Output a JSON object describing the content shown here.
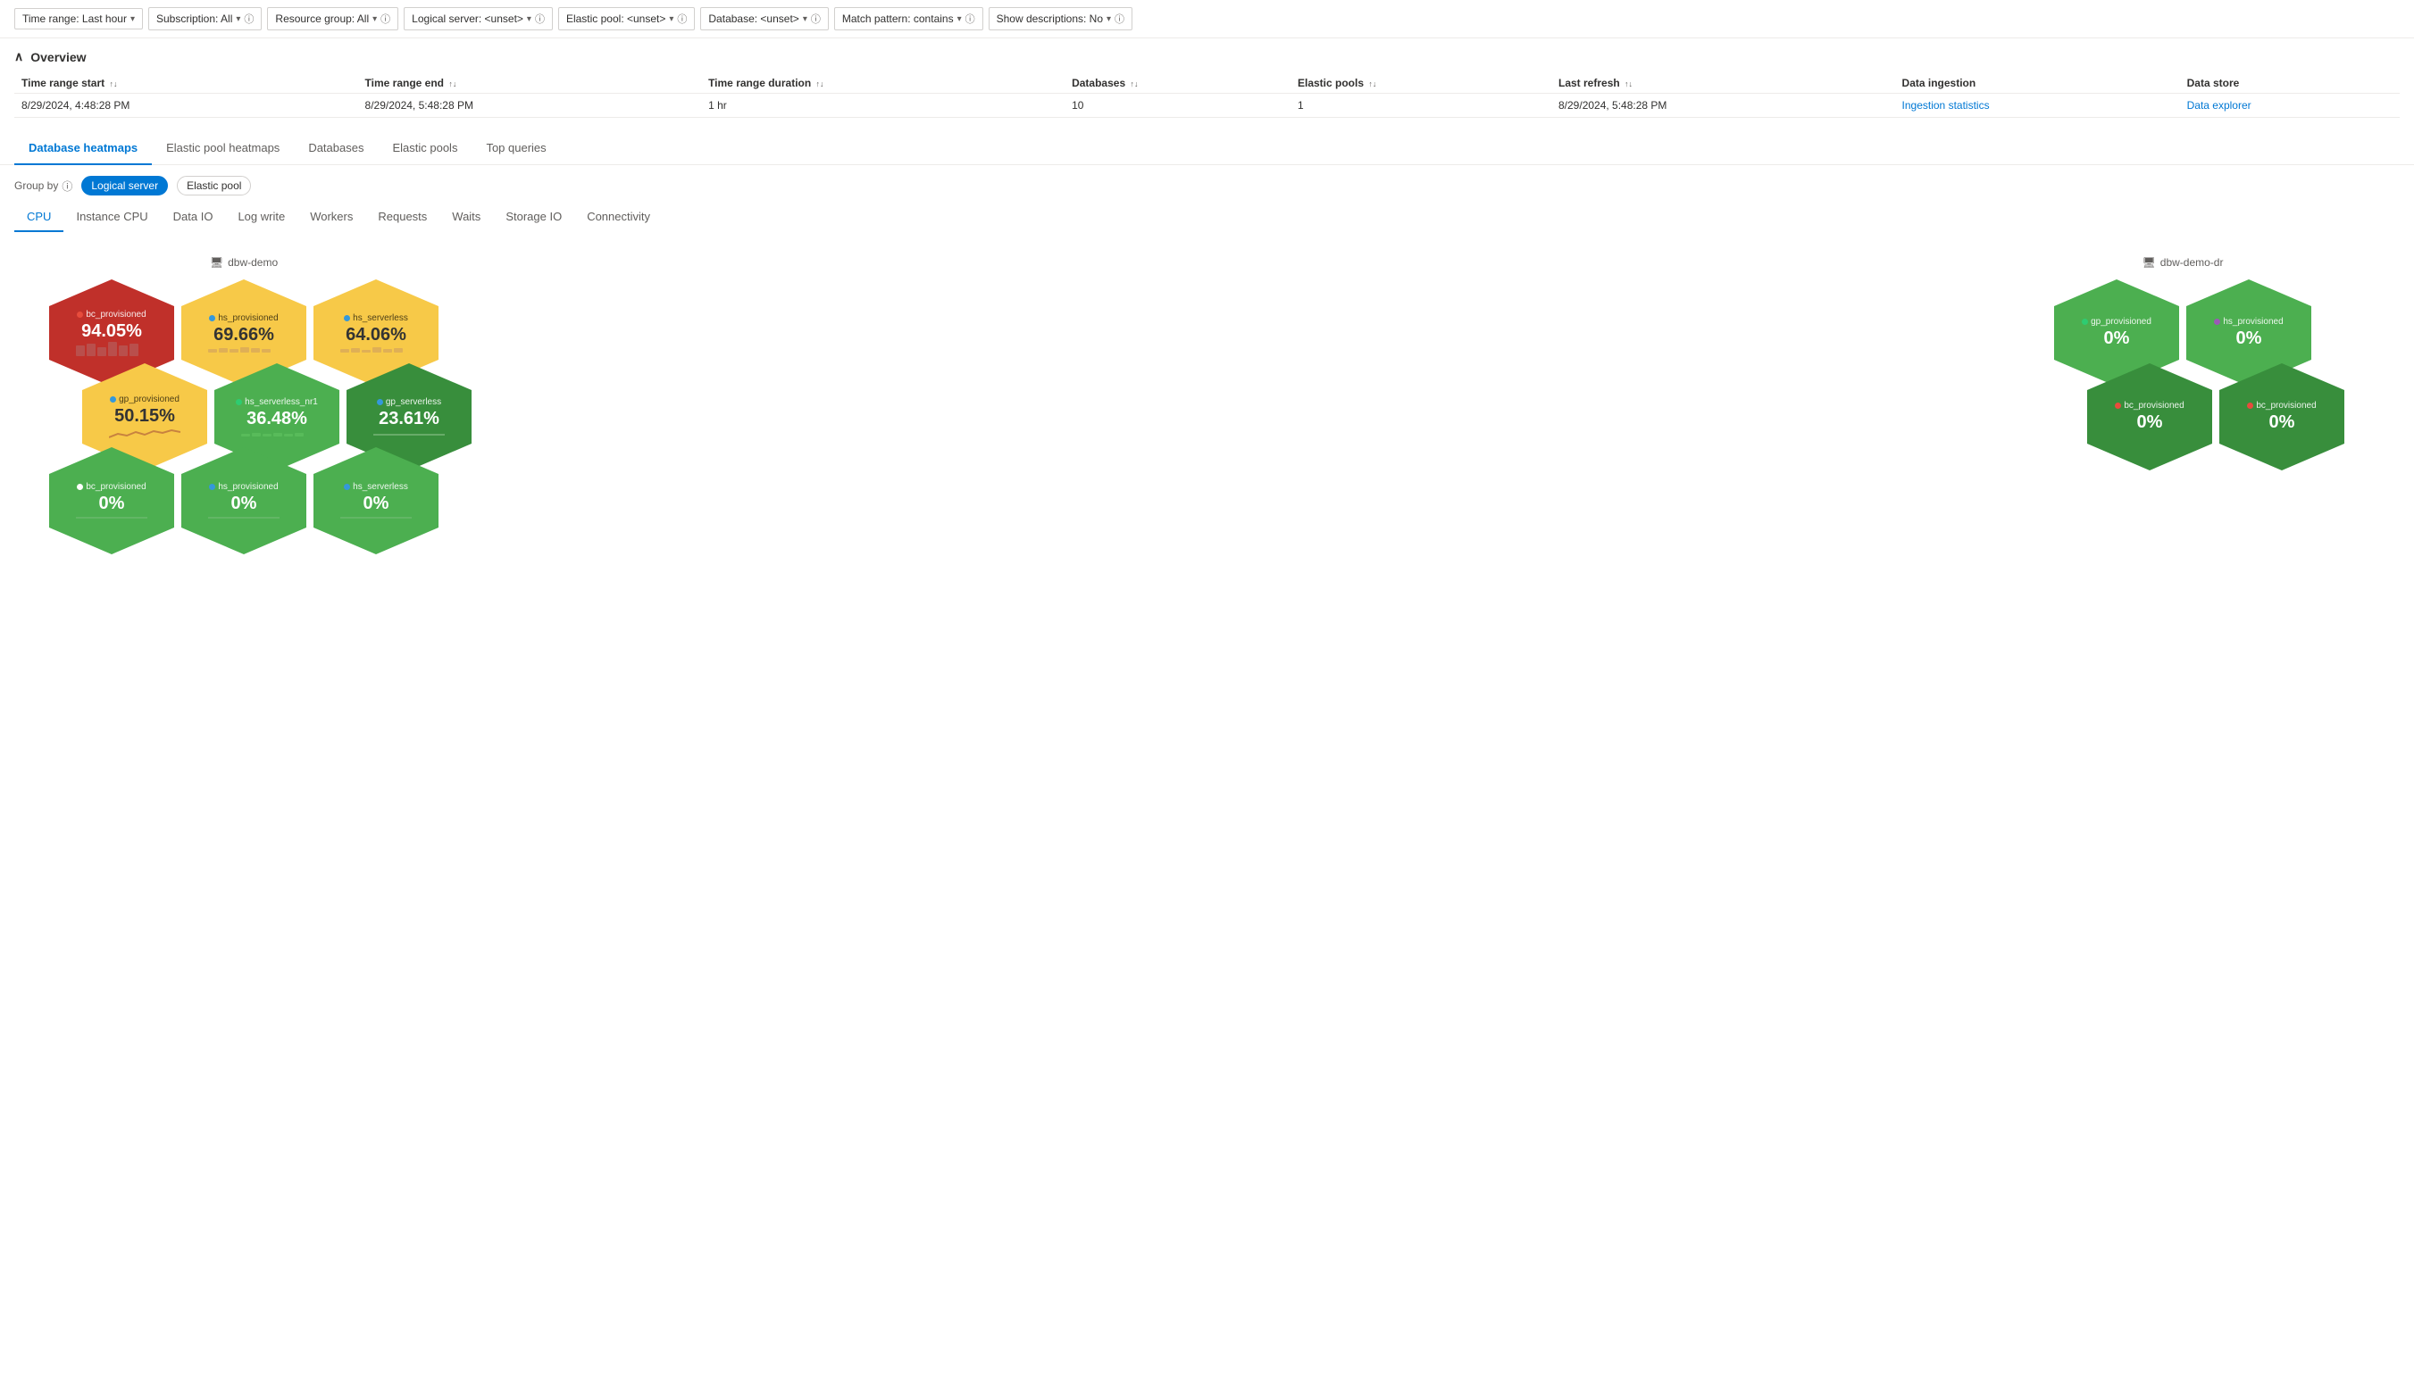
{
  "filters": [
    {
      "label": "Time range: Last hour",
      "has_chevron": true,
      "has_info": false
    },
    {
      "label": "Subscription: All",
      "has_chevron": true,
      "has_info": true
    },
    {
      "label": "Resource group: All",
      "has_chevron": true,
      "has_info": true
    },
    {
      "label": "Logical server: <unset>",
      "has_chevron": true,
      "has_info": true
    },
    {
      "label": "Elastic pool: <unset>",
      "has_chevron": true,
      "has_info": true
    },
    {
      "label": "Database: <unset>",
      "has_chevron": true,
      "has_info": true
    },
    {
      "label": "Match pattern: contains",
      "has_chevron": true,
      "has_info": true
    },
    {
      "label": "Show descriptions: No",
      "has_chevron": true,
      "has_info": true
    }
  ],
  "overview": {
    "title": "Overview",
    "columns": [
      "Time range start",
      "Time range end",
      "Time range duration",
      "Databases",
      "Elastic pools",
      "Last refresh",
      "Data ingestion",
      "Data store"
    ],
    "row": {
      "time_start": "8/29/2024, 4:48:28 PM",
      "time_end": "8/29/2024, 5:48:28 PM",
      "duration": "1 hr",
      "databases": "10",
      "elastic_pools": "1",
      "last_refresh": "8/29/2024, 5:48:28 PM",
      "ingestion_link": "Ingestion statistics",
      "data_store_link": "Data explorer"
    }
  },
  "main_tabs": [
    {
      "label": "Database heatmaps",
      "active": true
    },
    {
      "label": "Elastic pool heatmaps",
      "active": false
    },
    {
      "label": "Databases",
      "active": false
    },
    {
      "label": "Elastic pools",
      "active": false
    },
    {
      "label": "Top queries",
      "active": false
    }
  ],
  "group_by": {
    "label": "Group by",
    "options": [
      {
        "label": "Logical server",
        "active": true
      },
      {
        "label": "Elastic pool",
        "active": false
      }
    ]
  },
  "sub_tabs": [
    {
      "label": "CPU",
      "active": true
    },
    {
      "label": "Instance CPU",
      "active": false
    },
    {
      "label": "Data IO",
      "active": false
    },
    {
      "label": "Log write",
      "active": false
    },
    {
      "label": "Workers",
      "active": false
    },
    {
      "label": "Requests",
      "active": false
    },
    {
      "label": "Waits",
      "active": false
    },
    {
      "label": "Storage IO",
      "active": false
    },
    {
      "label": "Connectivity",
      "active": false
    }
  ],
  "heatmap_left": {
    "server_name": "dbw-demo",
    "hexagons": [
      {
        "row": 0,
        "cells": [
          {
            "name": "bc_provisioned",
            "value": "94.05%",
            "color": "red",
            "dot_color": "#e74c3c",
            "sparkline": "high"
          },
          {
            "name": "hs_provisioned",
            "value": "69.66%",
            "color": "yellow",
            "dot_color": "#3498db",
            "sparkline": "medium"
          },
          {
            "name": "hs_serverless",
            "value": "64.06%",
            "color": "yellow",
            "dot_color": "#3498db",
            "sparkline": "medium"
          }
        ]
      },
      {
        "row": 1,
        "cells": [
          {
            "name": "gp_provisioned",
            "value": "50.15%",
            "color": "yellow",
            "dot_color": "#3498db",
            "sparkline": "wave"
          },
          {
            "name": "hs_serverless_nr1",
            "value": "36.48%",
            "color": "green",
            "dot_color": "#2ecc71",
            "sparkline": "low"
          },
          {
            "name": "gp_serverless",
            "value": "23.61%",
            "color": "dark-green",
            "dot_color": "#3498db",
            "sparkline": "flat"
          }
        ]
      },
      {
        "row": 2,
        "cells": [
          {
            "name": "bc_provisioned",
            "value": "0%",
            "color": "green",
            "dot_color": "#fff",
            "sparkline": "flat"
          },
          {
            "name": "hs_provisioned",
            "value": "0%",
            "color": "green",
            "dot_color": "#3498db",
            "sparkline": "flat"
          },
          {
            "name": "hs_serverless",
            "value": "0%",
            "color": "green",
            "dot_color": "#3498db",
            "sparkline": "flat"
          }
        ]
      }
    ]
  },
  "heatmap_right": {
    "server_name": "dbw-demo-dr",
    "hexagons": [
      {
        "row": 0,
        "cells": [
          {
            "name": "gp_provisioned",
            "value": "0%",
            "color": "green",
            "dot_color": "#2ecc71"
          },
          {
            "name": "hs_provisioned",
            "value": "0%",
            "color": "green",
            "dot_color": "#9b59b6"
          }
        ]
      },
      {
        "row": 1,
        "cells": [
          {
            "name": "bc_provisioned",
            "value": "0%",
            "color": "dark-green",
            "dot_color": "#e74c3c"
          },
          {
            "name": "bc_provisioned",
            "value": "0%",
            "color": "dark-green",
            "dot_color": "#e74c3c"
          }
        ]
      }
    ]
  }
}
